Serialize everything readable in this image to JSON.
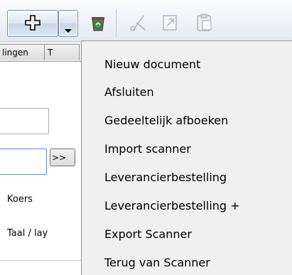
{
  "toolbar": {
    "buttons": [
      {
        "name": "plus-icon",
        "label": ""
      },
      {
        "name": "chevron-down-icon",
        "label": ""
      },
      {
        "name": "recycle-bin-icon",
        "label": ""
      },
      {
        "name": "scissors-icon",
        "label": ""
      },
      {
        "name": "copy-icon",
        "label": ""
      },
      {
        "name": "paste-icon",
        "label": ""
      }
    ]
  },
  "tabs": [
    {
      "label": "lingen"
    },
    {
      "label": "T"
    }
  ],
  "form": {
    "browse_label": ">>",
    "koers_label": "Koers",
    "taal_label": "Taal / lay"
  },
  "menu": {
    "items": [
      {
        "label": "Nieuw document"
      },
      {
        "label": "Afsluiten"
      },
      {
        "label": "Gedeeltelijk afboeken"
      },
      {
        "label": "Import scanner"
      },
      {
        "label": "Leverancierbestelling"
      },
      {
        "label": "Leverancierbestelling +"
      },
      {
        "label": "Export Scanner"
      },
      {
        "label": "Terug van Scanner"
      }
    ]
  }
}
